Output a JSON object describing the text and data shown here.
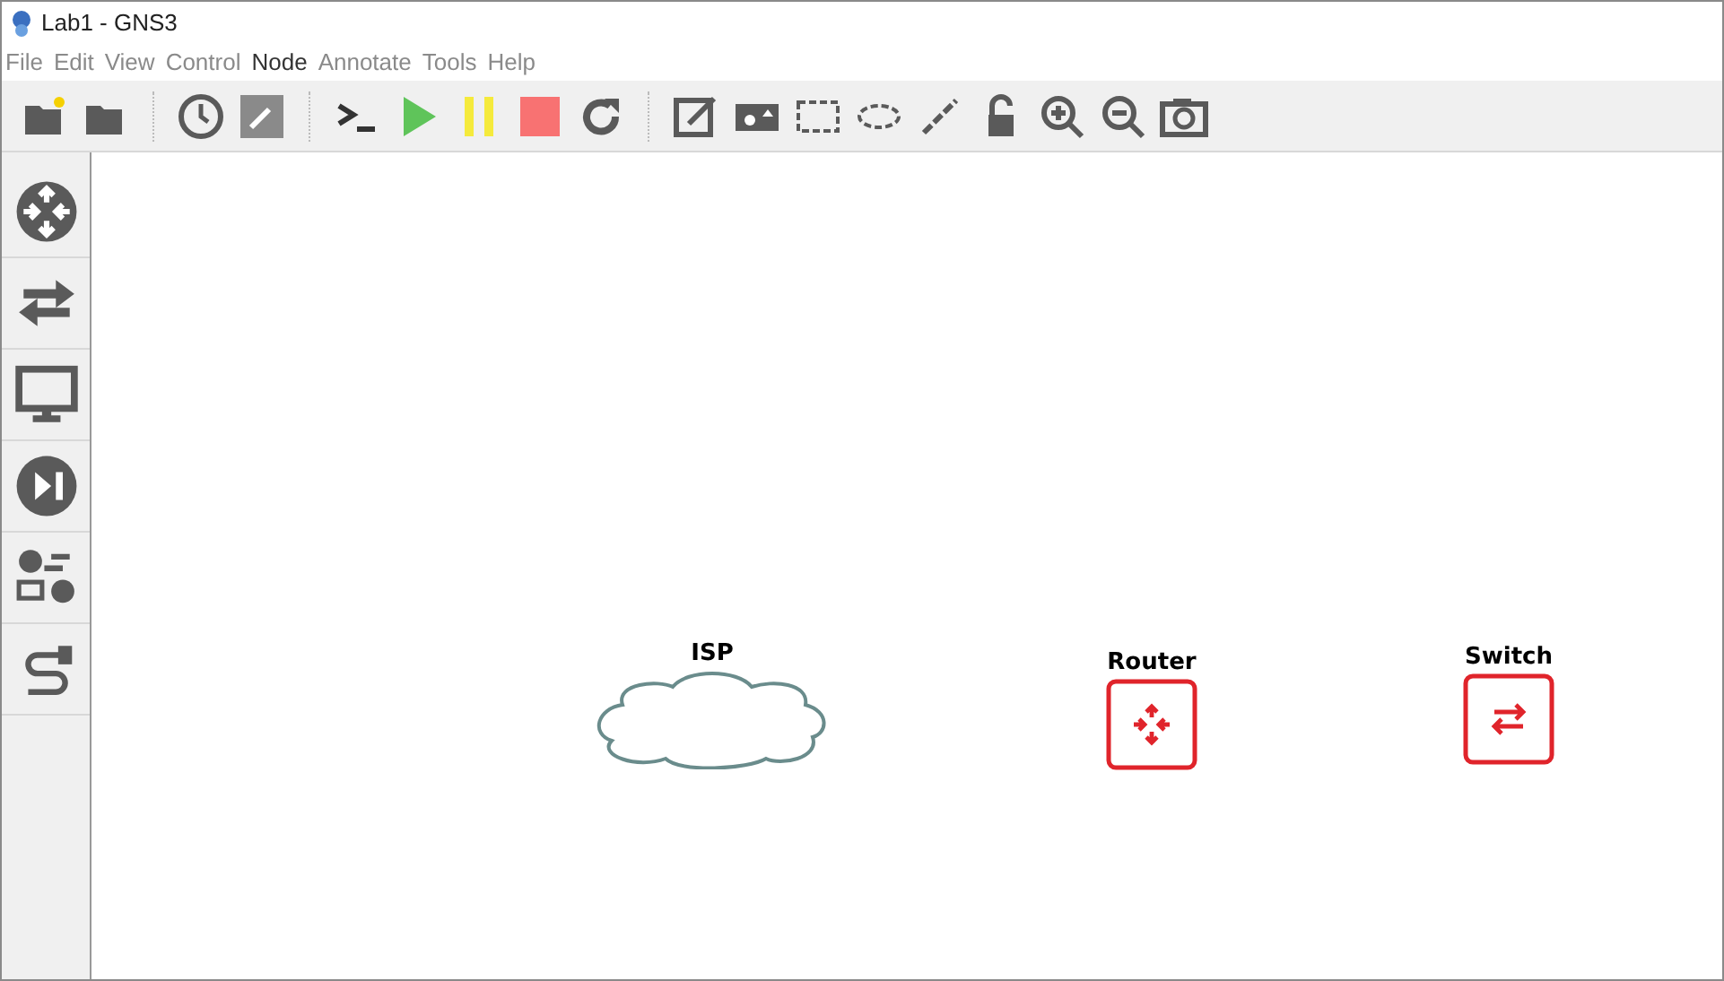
{
  "window": {
    "title": "Lab1 - GNS3"
  },
  "menu": [
    {
      "label": "File",
      "selected": false
    },
    {
      "label": "Edit",
      "selected": false
    },
    {
      "label": "View",
      "selected": false
    },
    {
      "label": "Control",
      "selected": false
    },
    {
      "label": "Node",
      "selected": true
    },
    {
      "label": "Annotate",
      "selected": false
    },
    {
      "label": "Tools",
      "selected": false
    },
    {
      "label": "Help",
      "selected": false
    }
  ],
  "canvas": {
    "nodes": [
      {
        "kind": "cloud",
        "label": "ISP"
      },
      {
        "kind": "router",
        "label": "Router"
      },
      {
        "kind": "switch",
        "label": "Switch"
      }
    ]
  }
}
